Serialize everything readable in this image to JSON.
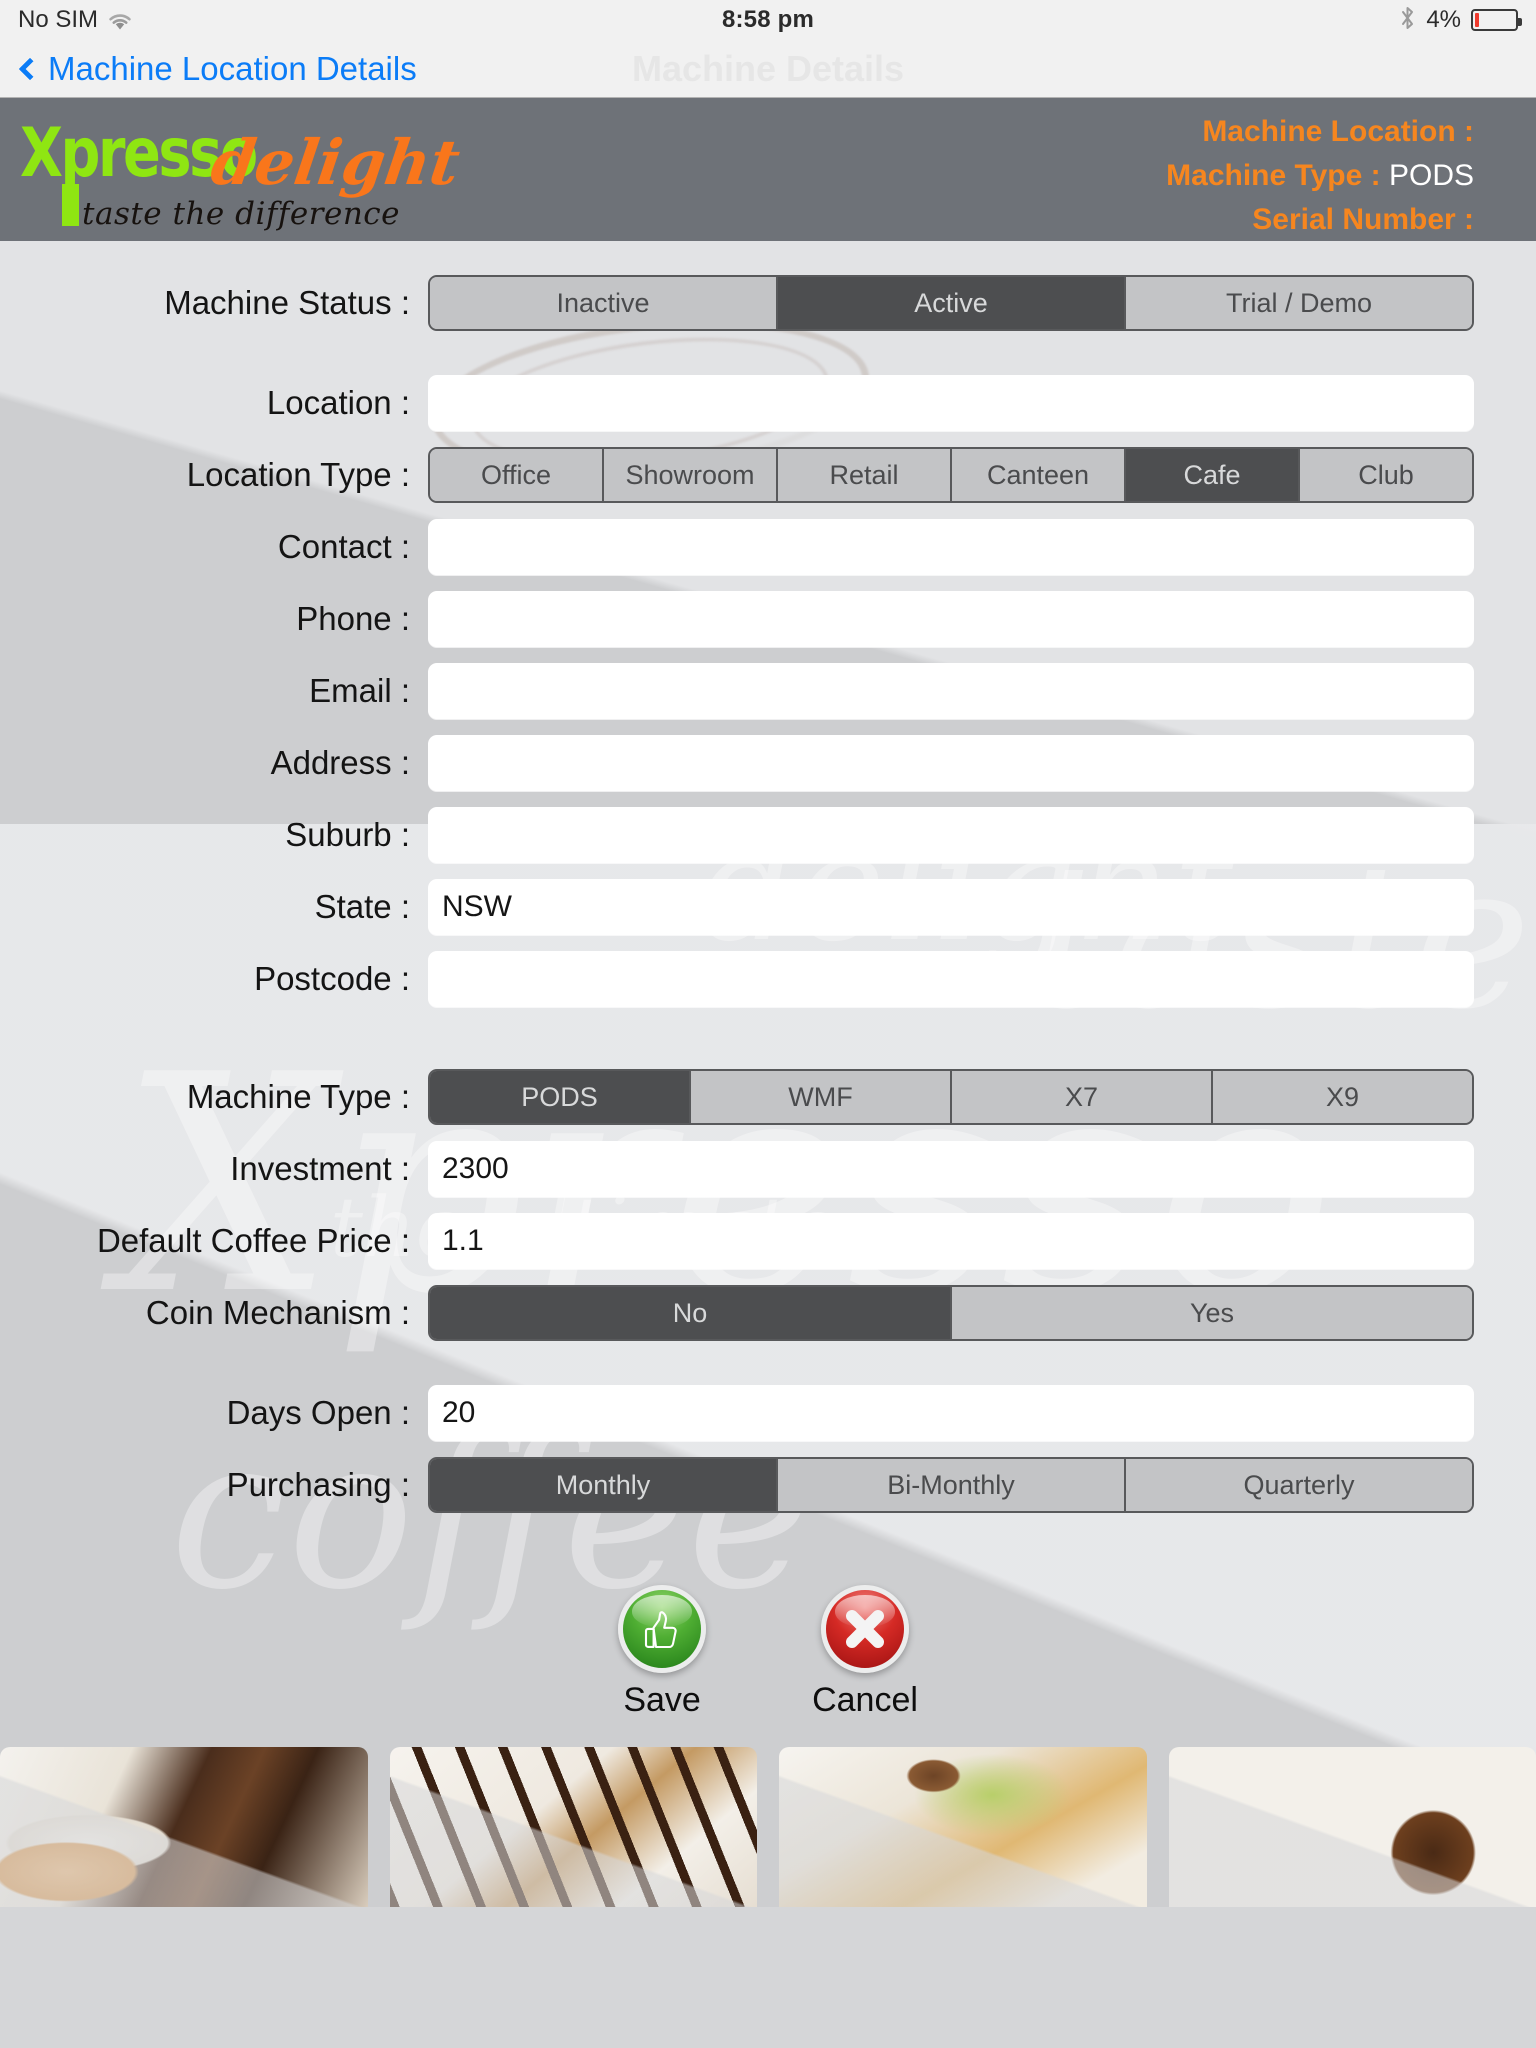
{
  "status_bar": {
    "carrier": "No SIM",
    "wifi_icon": "wifi-icon",
    "time": "8:58 pm",
    "bluetooth_icon": "bluetooth-icon",
    "battery_percent": "4%"
  },
  "nav_bar": {
    "back_icon": "chevron-left-icon",
    "back_label": "Machine Location Details",
    "title": "Machine Details"
  },
  "brand": {
    "logo_primary": "Xpresso",
    "logo_secondary": "delight",
    "tagline": "taste the difference",
    "colors": {
      "green": "#8fe612",
      "orange": "#f9761b",
      "header_bg": "#6e7278",
      "label_orange": "#f6861f"
    },
    "info": [
      {
        "label": "Machine Location :",
        "value": ""
      },
      {
        "label": "Machine Type :",
        "value": "PODS"
      },
      {
        "label": "Serial Number :",
        "value": ""
      }
    ]
  },
  "form": {
    "machine_status": {
      "label": "Machine Status :",
      "options": [
        "Inactive",
        "Active",
        "Trial / Demo"
      ],
      "selected": "Active"
    },
    "location": {
      "label": "Location :",
      "value": "",
      "placeholder": ""
    },
    "location_type": {
      "label": "Location Type :",
      "options": [
        "Office",
        "Showroom",
        "Retail",
        "Canteen",
        "Cafe",
        "Club"
      ],
      "selected": "Cafe"
    },
    "contact": {
      "label": "Contact :",
      "value": "",
      "placeholder": ""
    },
    "phone": {
      "label": "Phone :",
      "value": "",
      "placeholder": ""
    },
    "email": {
      "label": "Email :",
      "value": "",
      "placeholder": ""
    },
    "address": {
      "label": "Address :",
      "value": "",
      "placeholder": ""
    },
    "suburb": {
      "label": "Suburb :",
      "value": "",
      "placeholder": ""
    },
    "state": {
      "label": "State :",
      "value": "NSW",
      "placeholder": ""
    },
    "postcode": {
      "label": "Postcode :",
      "value": "",
      "placeholder": ""
    },
    "machine_type": {
      "label": "Machine Type :",
      "options": [
        "PODS",
        "WMF",
        "X7",
        "X9"
      ],
      "selected": "PODS"
    },
    "investment": {
      "label": "Investment :",
      "value": "2300",
      "placeholder": ""
    },
    "default_coffee_price": {
      "label": "Default Coffee Price :",
      "value": "1.1",
      "placeholder": ""
    },
    "coin_mechanism": {
      "label": "Coin Mechanism :",
      "options": [
        "No",
        "Yes"
      ],
      "selected": "No"
    },
    "days_open": {
      "label": "Days Open :",
      "value": "20",
      "placeholder": ""
    },
    "purchasing": {
      "label": "Purchasing :",
      "options": [
        "Monthly",
        "Bi-Monthly",
        "Quarterly"
      ],
      "selected": "Monthly"
    }
  },
  "actions": {
    "save": {
      "label": "Save",
      "icon": "thumbs-up-icon",
      "color": "#2f8f1f"
    },
    "cancel": {
      "label": "Cancel",
      "icon": "close-x-icon",
      "color": "#c9241f"
    }
  },
  "photo_strip": {
    "photos": [
      "latte-art-photo",
      "chocolate-drizzle-photo",
      "cappuccino-photo",
      "coffee-beans-photo"
    ]
  },
  "watermarks": [
    "Xpresso",
    "taste of",
    "the ultimate",
    "coffee",
    "delight"
  ]
}
